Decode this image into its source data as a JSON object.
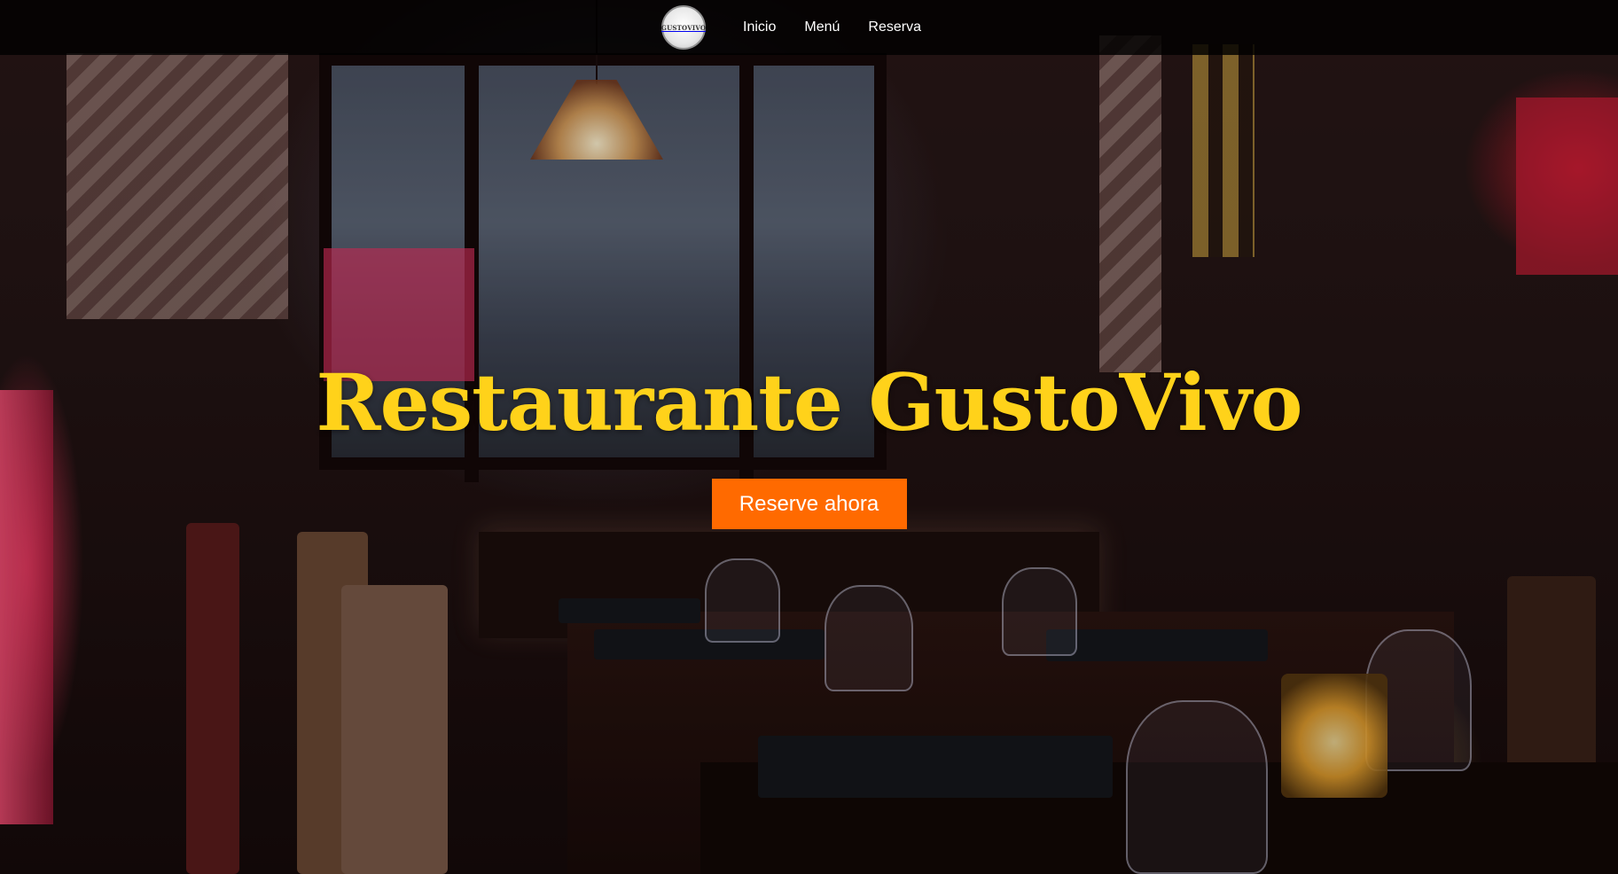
{
  "navbar": {
    "logo_text": "GUSTOVIVO",
    "links": [
      {
        "label": "Inicio"
      },
      {
        "label": "Menú"
      },
      {
        "label": "Reserva"
      }
    ]
  },
  "hero": {
    "title": "Restaurante GustoVivo",
    "cta_label": "Reserve ahora"
  },
  "colors": {
    "title": "#ffd21a",
    "cta_background": "#ff6a00",
    "navbar_background": "#000000"
  },
  "icons": {
    "logo": "gustovivo-logo-icon"
  }
}
